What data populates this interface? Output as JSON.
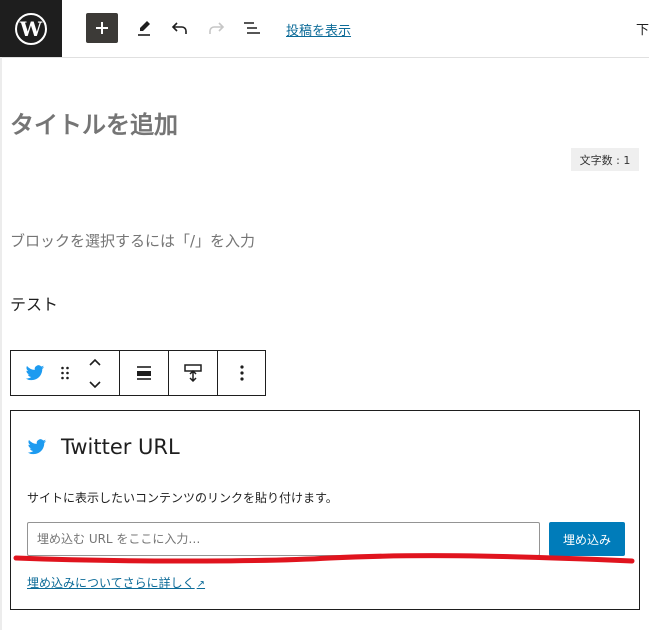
{
  "topbar": {
    "logo_letter": "W",
    "view_post_label": "投稿を表示",
    "cut_text": "下"
  },
  "editor": {
    "title_placeholder": "タイトルを追加",
    "word_count": "文字数 : 1",
    "block_placeholder": "ブロックを選択するには「/」を入力",
    "paragraph_text": "テスト"
  },
  "embed": {
    "title": "Twitter URL",
    "description": "サイトに表示したいコンテンツのリンクを貼り付けます。",
    "input_placeholder": "埋め込む URL をここに入力…",
    "embed_button_label": "埋め込み",
    "learn_more_label": "埋め込みについてさらに詳しく"
  },
  "colors": {
    "accent": "#007cba",
    "link": "#0c6b98",
    "twitter": "#1d9bf0",
    "annotation": "#e0141e"
  }
}
